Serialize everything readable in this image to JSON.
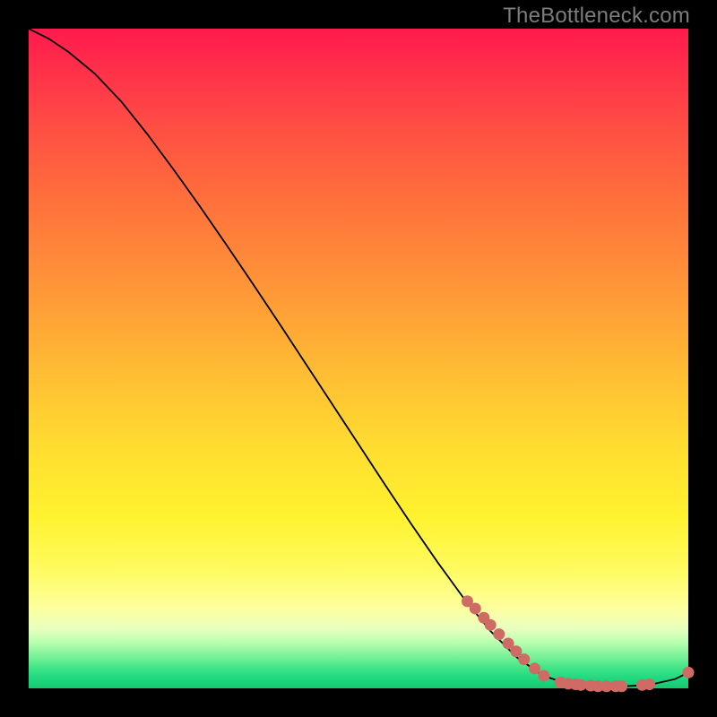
{
  "watermark": "TheBottleneck.com",
  "colors": {
    "dot": "#d06a64",
    "curve": "#000000"
  },
  "chart_data": {
    "type": "line",
    "title": "",
    "xlabel": "",
    "ylabel": "",
    "xlim": [
      0,
      100
    ],
    "ylim": [
      0,
      100
    ],
    "series": [
      {
        "name": "curve",
        "x": [
          0,
          3,
          6,
          10,
          14,
          18,
          22,
          26,
          30,
          34,
          38,
          42,
          46,
          50,
          54,
          58,
          62,
          66,
          70,
          74,
          78,
          82,
          86,
          90,
          94,
          98,
          100
        ],
        "y": [
          100,
          98.5,
          96.5,
          93.2,
          89.0,
          84.0,
          78.6,
          73.0,
          67.2,
          61.3,
          55.3,
          49.2,
          43.1,
          37.0,
          30.9,
          24.9,
          19.1,
          13.6,
          8.7,
          4.7,
          1.9,
          0.6,
          0.3,
          0.3,
          0.5,
          1.4,
          2.4
        ]
      }
    ],
    "scatter": [
      {
        "name": "dots",
        "points": [
          {
            "x": 66.5,
            "y": 13.2
          },
          {
            "x": 67.7,
            "y": 12.1
          },
          {
            "x": 69.0,
            "y": 10.7
          },
          {
            "x": 70.0,
            "y": 9.6
          },
          {
            "x": 71.3,
            "y": 8.2
          },
          {
            "x": 72.7,
            "y": 6.8
          },
          {
            "x": 73.9,
            "y": 5.6
          },
          {
            "x": 75.1,
            "y": 4.4
          },
          {
            "x": 76.7,
            "y": 3.0
          },
          {
            "x": 78.1,
            "y": 1.9
          },
          {
            "x": 80.6,
            "y": 0.9
          },
          {
            "x": 81.8,
            "y": 0.7
          },
          {
            "x": 82.9,
            "y": 0.6
          },
          {
            "x": 83.7,
            "y": 0.5
          },
          {
            "x": 85.2,
            "y": 0.4
          },
          {
            "x": 86.3,
            "y": 0.3
          },
          {
            "x": 87.6,
            "y": 0.3
          },
          {
            "x": 89.0,
            "y": 0.3
          },
          {
            "x": 89.9,
            "y": 0.3
          },
          {
            "x": 93.0,
            "y": 0.5
          },
          {
            "x": 94.1,
            "y": 0.6
          },
          {
            "x": 100.0,
            "y": 2.4
          }
        ]
      }
    ]
  }
}
